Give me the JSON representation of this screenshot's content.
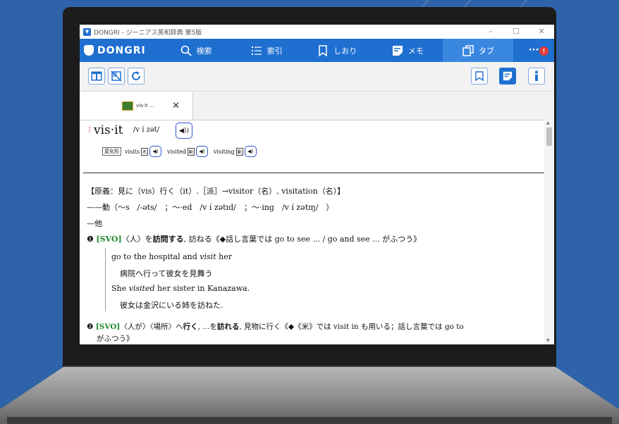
{
  "window": {
    "title": "DONGRI - ジーニアス英和辞典 第5版",
    "controls": [
      "–",
      "☐",
      "✕"
    ]
  },
  "nav": {
    "logo": "DONGRI",
    "items": [
      {
        "label": "検索",
        "icon": "search-icon"
      },
      {
        "label": "索引",
        "icon": "list-icon"
      },
      {
        "label": "しおり",
        "icon": "bookmark-icon"
      },
      {
        "label": "メモ",
        "icon": "memo-icon"
      },
      {
        "label": "タブ",
        "icon": "tabs-icon"
      }
    ],
    "more": "···",
    "badge": "!"
  },
  "toolbar": {
    "left_icons": [
      "layout-icon",
      "no-image-icon",
      "refresh-icon"
    ],
    "right_icons": [
      "bookmark-icon",
      "memo-icon",
      "info-icon"
    ]
  },
  "tab": {
    "label": "vis·it ...",
    "close": "✕"
  },
  "entry": {
    "mark": "⁝",
    "headword": "vis·it",
    "pronunciation": "/v í zət/",
    "forms_tag": "変化形",
    "forms": [
      {
        "word": "visits",
        "pos": "名"
      },
      {
        "word": "visited",
        "pos": "動"
      },
      {
        "word": "visiting",
        "pos": "動"
      }
    ],
    "etymology": "【原義：見に（vis）行く（it）.［派］→visitor（名）, visitation（名）】",
    "inflection_line": "——動（〜s　/-əts/　；〜·ed　/v í zətɪd/　；〜·ing　/v í zətɪŋ/　）",
    "subhead": "—他",
    "sense1": {
      "num": "❶",
      "pattern": "[SVO]",
      "text_a": "〈人〉を",
      "bold": "訪問する",
      "text_b": ", 訪ねる《◆話し言葉では go to see ... / go and see ... がふつう》"
    },
    "examples": [
      {
        "en_before": "go to the hospital and ",
        "en_em": "visit",
        "en_after": " her",
        "ja": "病院へ行って彼女を見舞う"
      },
      {
        "en_before": "She ",
        "en_em": "visited",
        "en_after": " her sister in Kanazawa.",
        "ja": "彼女は金沢にいる姉を訪ねた."
      }
    ],
    "sense2": {
      "num": "❷",
      "pattern": "[SVO]",
      "text_a": "〈人が〉〈場所〉へ",
      "bold1": "行く",
      "text_b": ", ...を",
      "bold2": "訪れる",
      "text_c": ", 見物に行く《◆《米》では visit in も用いる；話し言葉では go to",
      "cont": "がふつう》"
    }
  }
}
